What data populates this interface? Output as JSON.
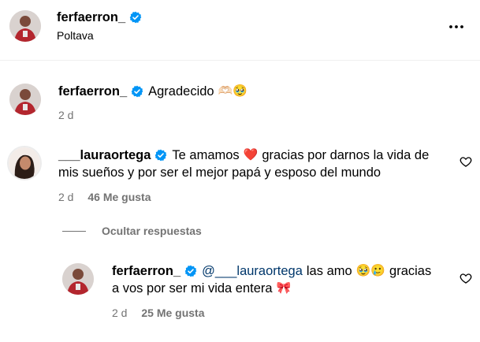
{
  "post_header": {
    "username": "ferfaerron_",
    "location": "Poltava",
    "more_icon": "more-horizontal-icon"
  },
  "caption": {
    "username": "ferfaerron_",
    "text": "Agradecido",
    "emojis": "🫶🏻🥹",
    "time": "2 d"
  },
  "comment": {
    "username": "___laurаortega",
    "text_before_heart": "Te amamos",
    "heart_emoji": "❤️",
    "text_after_heart": "gracias por darnos la vida de",
    "text_line2": "mis sueños y por ser el mejor papá y esposo del mundo",
    "time": "2 d",
    "likes": "46 Me gusta",
    "like_icon": "heart-outline-icon"
  },
  "replies_toggle": {
    "label": "Ocultar respuestas"
  },
  "reply": {
    "username": "ferfaerron_",
    "mention": "@___lauraortega",
    "text_line1": "las amo",
    "emojis_1": "🥹🥲",
    "text_line1_end": "gracias",
    "text_line2": "a vos por ser mi vida entera",
    "emoji_2": "🎀",
    "time": "2 d",
    "likes": "25 Me gusta",
    "like_icon": "heart-outline-icon"
  },
  "colors": {
    "verified_blue": "#0095f6",
    "secondary_text": "#737373",
    "mention_blue": "#00376b",
    "divider": "#efefef"
  }
}
